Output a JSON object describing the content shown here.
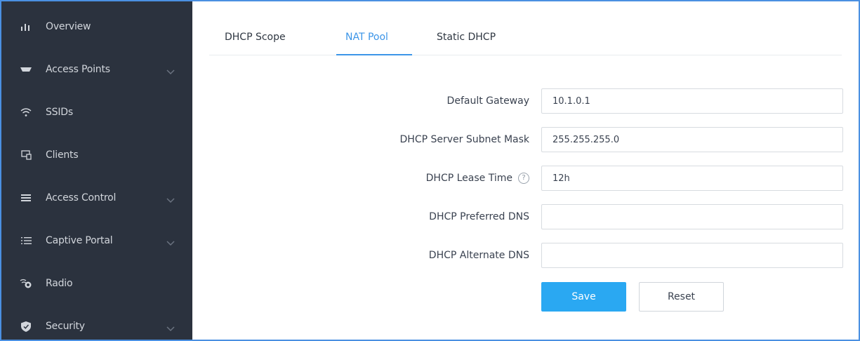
{
  "sidebar": {
    "items": [
      {
        "label": "Overview",
        "icon": "bar-chart-icon",
        "has_submenu": false
      },
      {
        "label": "Access Points",
        "icon": "access-point-icon",
        "has_submenu": true
      },
      {
        "label": "SSIDs",
        "icon": "wifi-icon",
        "has_submenu": false
      },
      {
        "label": "Clients",
        "icon": "clients-icon",
        "has_submenu": false
      },
      {
        "label": "Access Control",
        "icon": "list-icon",
        "has_submenu": true
      },
      {
        "label": "Captive Portal",
        "icon": "menu-icon",
        "has_submenu": true
      },
      {
        "label": "Radio",
        "icon": "radio-icon",
        "has_submenu": false
      },
      {
        "label": "Security",
        "icon": "shield-icon",
        "has_submenu": true
      }
    ]
  },
  "tabs": [
    {
      "label": "DHCP Scope",
      "active": false
    },
    {
      "label": "NAT Pool",
      "active": true
    },
    {
      "label": "Static DHCP",
      "active": false
    }
  ],
  "form": {
    "default_gateway": {
      "label": "Default Gateway",
      "value": "10.1.0.1"
    },
    "subnet_mask": {
      "label": "DHCP Server Subnet Mask",
      "value": "255.255.255.0"
    },
    "lease_time": {
      "label": "DHCP Lease Time",
      "value": "12h",
      "help": "?"
    },
    "preferred_dns": {
      "label": "DHCP Preferred DNS",
      "value": ""
    },
    "alternate_dns": {
      "label": "DHCP Alternate DNS",
      "value": ""
    }
  },
  "buttons": {
    "save": "Save",
    "reset": "Reset"
  },
  "colors": {
    "sidebar_bg": "#2b323e",
    "accent": "#3c95e8",
    "save_button": "#2aa8f2"
  }
}
